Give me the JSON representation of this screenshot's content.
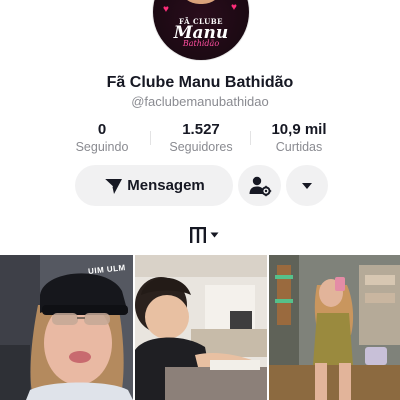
{
  "avatar": {
    "logo_small": "FÃ CLUBE",
    "logo_big": "Manu",
    "logo_script": "Bathidão"
  },
  "profile": {
    "name": "Fã Clube Manu Bathidão",
    "handle": "@faclubemanubathidao"
  },
  "stats": [
    {
      "value": "0",
      "label": "Seguindo"
    },
    {
      "value": "1.527",
      "label": "Seguidores"
    },
    {
      "value": "10,9 mil",
      "label": "Curtidas"
    }
  ],
  "actions": {
    "message_label": "Mensagem",
    "message_icon": "send-icon",
    "follow_icon": "user-settings-icon",
    "more_icon": "chevron-down-icon"
  },
  "tabs": {
    "videos_icon": "grid-icon",
    "filter_icon": "caret-down-icon"
  },
  "thumbnails": [
    {
      "cap_text": "UIM ULM"
    },
    {},
    {}
  ],
  "colors": {
    "text_primary": "#161823",
    "text_secondary": "#8a8b91",
    "button_bg": "#f1f1f2",
    "accent_pink": "#ff2d7a"
  }
}
